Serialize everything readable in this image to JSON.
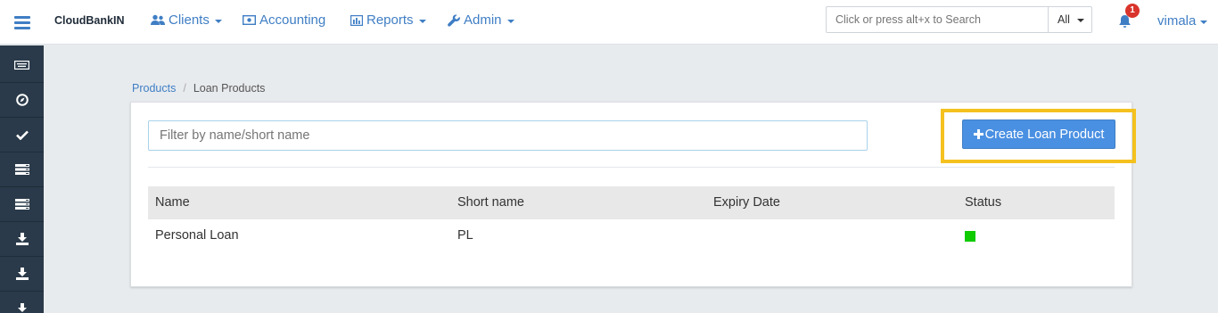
{
  "app": {
    "brand": "CloudBankIN"
  },
  "nav": {
    "clients": "Clients",
    "accounting": "Accounting",
    "reports": "Reports",
    "admin": "Admin"
  },
  "search": {
    "placeholder": "Click or press alt+x to Search",
    "scope": "All"
  },
  "notifications": {
    "count": "1"
  },
  "user": {
    "name": "vimala"
  },
  "sidebar": {
    "items": [
      {
        "icon": "keyboard-icon"
      },
      {
        "icon": "compass-icon"
      },
      {
        "icon": "check-icon"
      },
      {
        "icon": "list-icon"
      },
      {
        "icon": "list-icon"
      },
      {
        "icon": "download-icon"
      },
      {
        "icon": "download-icon"
      },
      {
        "icon": "download-icon"
      }
    ]
  },
  "breadcrumb": {
    "parent": "Products",
    "separator": "/",
    "current": "Loan Products"
  },
  "filter": {
    "placeholder": "Filter by name/short name"
  },
  "actions": {
    "create_label": "Create Loan Product"
  },
  "table": {
    "headers": [
      "Name",
      "Short name",
      "Expiry Date",
      "Status"
    ],
    "rows": [
      {
        "name": "Personal Loan",
        "short_name": "PL",
        "expiry_date": "",
        "status_color": "#0fcb00"
      }
    ]
  },
  "colors": {
    "accent": "#3f7ec4",
    "button": "#4a90e2",
    "highlight": "#f4c11f",
    "sidebar": "#2a3a4a",
    "status_active": "#0fcb00"
  }
}
